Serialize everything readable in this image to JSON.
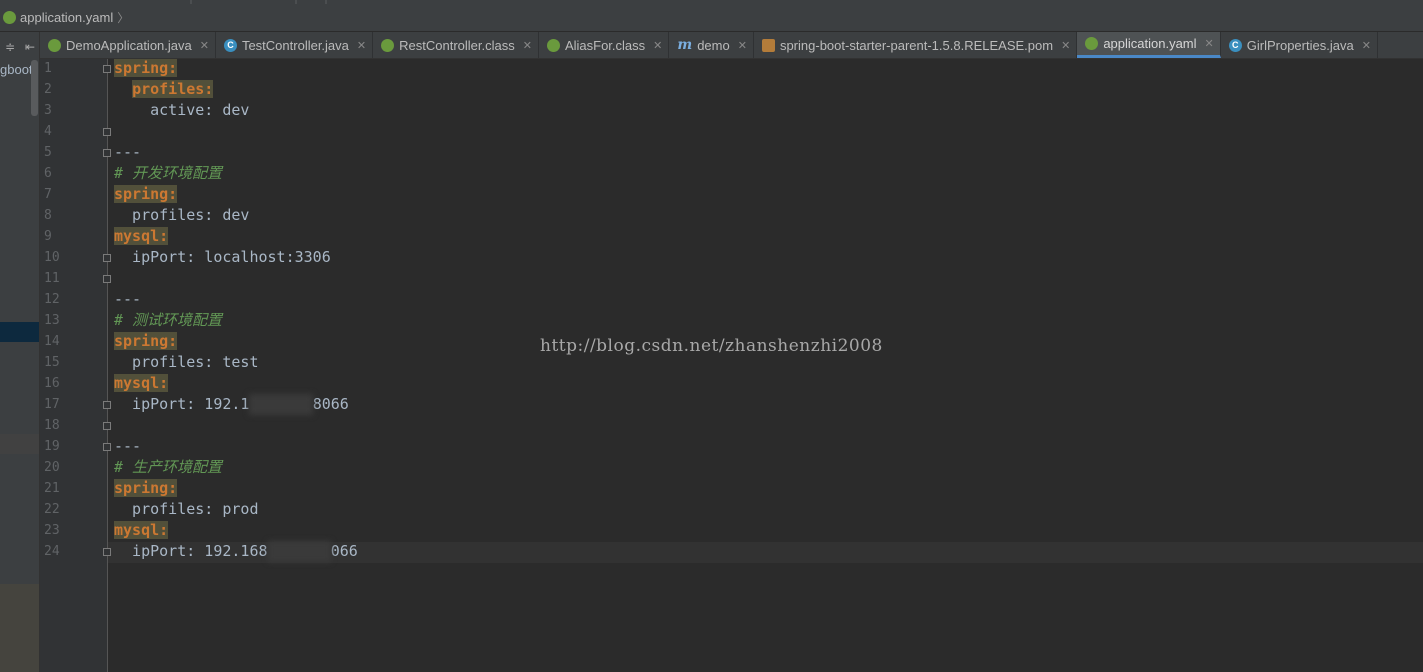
{
  "breadcrumb": {
    "file": "application.yaml",
    "icon": "spring-leaf-icon"
  },
  "project": {
    "label": "gboot"
  },
  "tabs": [
    {
      "label": "DemoApplication.java",
      "icon": "spring"
    },
    {
      "label": "TestController.java",
      "icon": "java"
    },
    {
      "label": "RestController.class",
      "icon": "spring"
    },
    {
      "label": "AliasFor.class",
      "icon": "spring"
    },
    {
      "label": "demo",
      "icon": "m"
    },
    {
      "label": "spring-boot-starter-parent-1.5.8.RELEASE.pom",
      "icon": "pom"
    },
    {
      "label": "application.yaml",
      "icon": "spring",
      "active": true
    },
    {
      "label": "GirlProperties.java",
      "icon": "java"
    }
  ],
  "editor": {
    "line_numbers": [
      "1",
      "2",
      "3",
      "4",
      "5",
      "6",
      "7",
      "8",
      "9",
      "10",
      "11",
      "12",
      "13",
      "14",
      "15",
      "16",
      "17",
      "18",
      "19",
      "20",
      "21",
      "22",
      "23",
      "24"
    ],
    "lines": [
      {
        "indent": "",
        "key": "spring:"
      },
      {
        "indent": "  ",
        "key": "profiles:"
      },
      {
        "text": "    active: dev"
      },
      {
        "text": ""
      },
      {
        "text": "---"
      },
      {
        "comment": "# 开发环境配置"
      },
      {
        "indent": "",
        "key": "spring:"
      },
      {
        "text": "  profiles: dev"
      },
      {
        "indent": "",
        "key": "mysql:"
      },
      {
        "text": "  ipPort: localhost:3306"
      },
      {
        "text": ""
      },
      {
        "text": "---"
      },
      {
        "comment": "# 测试环境配置"
      },
      {
        "indent": "",
        "key": "spring:"
      },
      {
        "text": "  profiles: test"
      },
      {
        "indent": "",
        "key": "mysql:"
      },
      {
        "blurred": true,
        "pre": "  ipPort: 192.1",
        "post": "8066"
      },
      {
        "text": ""
      },
      {
        "text": "---"
      },
      {
        "comment": "# 生产环境配置"
      },
      {
        "indent": "",
        "key": "spring:"
      },
      {
        "text": "  profiles: prod"
      },
      {
        "indent": "",
        "key": "mysql:"
      },
      {
        "blurred": true,
        "pre": "  ipPort: 192.168",
        "post": "066"
      }
    ]
  },
  "watermark": "http://blog.csdn.net/zhanshenzhi2008",
  "colors": {
    "key": "#cc7832",
    "comment": "#629755",
    "text": "#a9b7c6",
    "active_tab_underline": "#4a88c7"
  }
}
